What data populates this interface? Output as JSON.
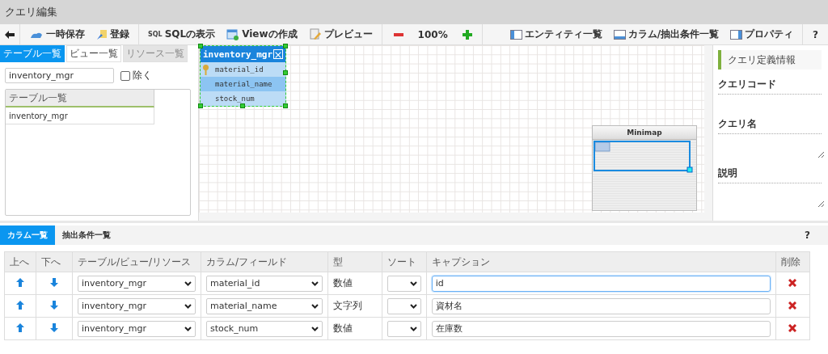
{
  "window": {
    "title": "クエリ編集"
  },
  "toolbar": {
    "left": [
      {
        "kind": "save",
        "label": "一時保存"
      },
      {
        "kind": "register",
        "label": "登録"
      },
      {
        "kind": "sql",
        "icon_text": "SQL",
        "label": "SQLの表示"
      },
      {
        "kind": "view",
        "label": "Viewの作成"
      },
      {
        "kind": "preview",
        "label": "プレビュー"
      }
    ],
    "zoom": "100%",
    "right": [
      {
        "kind": "entity",
        "label": "エンティティ一覧"
      },
      {
        "kind": "columns",
        "label": "カラム/抽出条件一覧"
      },
      {
        "kind": "property",
        "label": "プロパティ"
      }
    ],
    "help": "?"
  },
  "left_panel": {
    "tabs": [
      {
        "label": "テーブル一覧",
        "selected": true,
        "disabled": false
      },
      {
        "label": "ビュー一覧",
        "selected": false,
        "disabled": false
      },
      {
        "label": "リソース一覧",
        "selected": false,
        "disabled": true
      }
    ],
    "search": {
      "value": "inventory_mgr"
    },
    "exclude": {
      "label": "除く",
      "checked": false
    },
    "list": {
      "header": "テーブル一覧",
      "rows": [
        "inventory_mgr"
      ]
    }
  },
  "canvas": {
    "entity": {
      "name": "inventory_mgr",
      "fields": [
        {
          "name": "material_id",
          "key": true,
          "selected": false
        },
        {
          "name": "material_name",
          "key": false,
          "selected": true
        },
        {
          "name": "stock_num",
          "key": false,
          "selected": false
        }
      ]
    },
    "minimap": {
      "title": "Minimap"
    }
  },
  "right_panel": {
    "heading": "クエリ定義情報",
    "fields": [
      {
        "label": "クエリコード",
        "kind": "input"
      },
      {
        "label": "クエリ名",
        "kind": "textarea"
      },
      {
        "label": "説明",
        "kind": "textarea"
      }
    ]
  },
  "bottom": {
    "tabs": [
      {
        "label": "カラム一覧",
        "selected": true
      },
      {
        "label": "抽出条件一覧",
        "selected": false
      }
    ],
    "help": "?",
    "columns": [
      "上へ",
      "下へ",
      "テーブル/ビュー/リソース",
      "カラム/フィールド",
      "型",
      "ソート",
      "キャプション",
      "削除"
    ],
    "rows": [
      {
        "table": "inventory_mgr",
        "field": "material_id",
        "type": "数値",
        "caption": "id",
        "focused": true
      },
      {
        "table": "inventory_mgr",
        "field": "material_name",
        "type": "文字列",
        "caption": "資材名",
        "focused": false
      },
      {
        "table": "inventory_mgr",
        "field": "stock_num",
        "type": "数値",
        "caption": "在庫数",
        "focused": false
      }
    ]
  }
}
